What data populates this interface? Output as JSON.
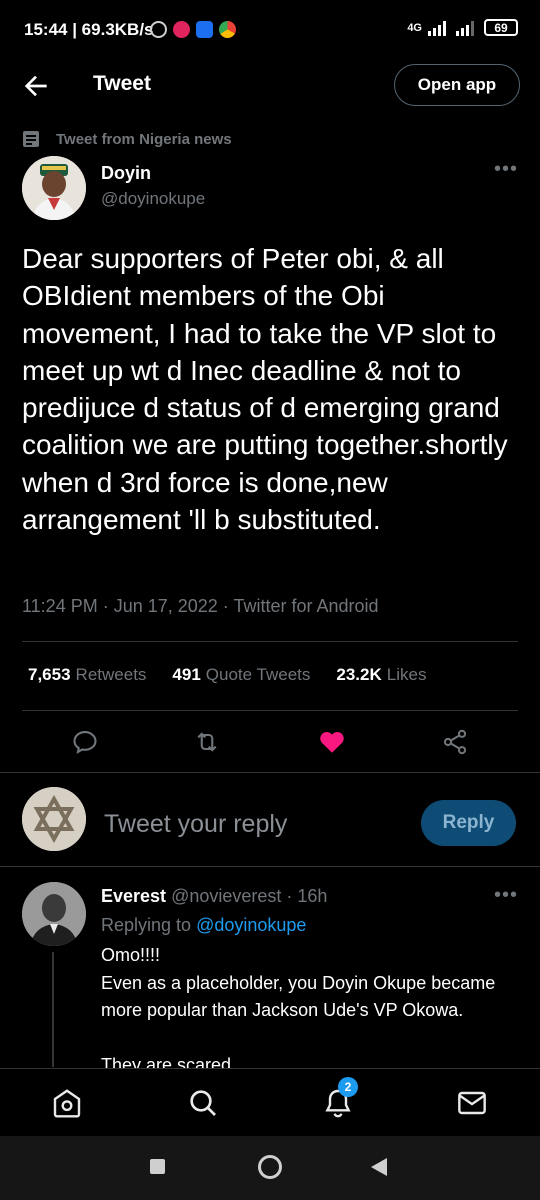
{
  "status_bar": {
    "time": "15:44 | 69.3KB/s",
    "network": "4G",
    "battery": "69",
    "colors": {
      "alarm": "#cfcfcf",
      "app1": "#e0245e",
      "app2": "#1d6ff2",
      "chrome": "#34a853"
    }
  },
  "header": {
    "title": "Tweet",
    "open_app_label": "Open app"
  },
  "context": {
    "label": "Tweet from Nigeria news"
  },
  "tweet": {
    "author_name": "Doyin",
    "author_handle": "@doyinokupe",
    "text": "Dear supporters of Peter obi, & all OBIdient members of the Obi movement, I had to take the VP slot to meet up wt d Inec deadline & not to predijuce d status of d emerging grand coalition we are putting together.shortly when d 3rd force is done,new arrangement 'll b substituted.",
    "meta": "11:24 PM · Jun 17, 2022 · Twitter for Android",
    "stats": {
      "retweets_count": "7,653",
      "retweets_label": "Retweets",
      "quotes_count": "491",
      "quotes_label": "Quote Tweets",
      "likes_count": "23.2K",
      "likes_label": "Likes"
    },
    "liked": true
  },
  "composer": {
    "placeholder": "Tweet your reply",
    "reply_button": "Reply"
  },
  "reply": {
    "name": "Everest",
    "handle_time": "@novieverest · 16h",
    "replying_prefix": "Replying to",
    "replying_to": "@doyinokupe",
    "text": "Omo!!!!\nEven as a placeholder, you Doyin Okupe became more popular than Jackson Ude's VP Okowa.\n\nThey are scared."
  },
  "bottom_nav": {
    "notification_badge": "2",
    "items": [
      "home-icon",
      "search-icon",
      "notifications-icon",
      "messages-icon"
    ]
  },
  "colors": {
    "accent": "#1d9bf0",
    "like": "#f91880",
    "background": "#000000",
    "secondary_text": "#71767b"
  }
}
